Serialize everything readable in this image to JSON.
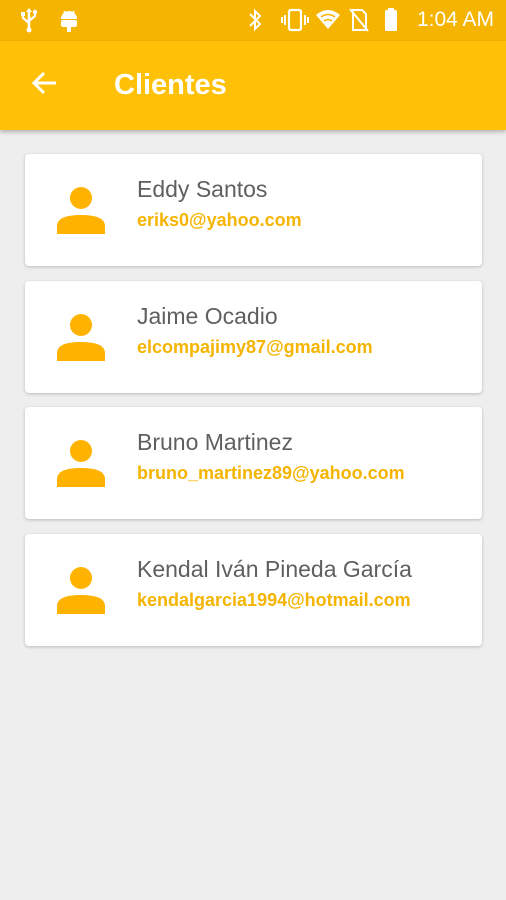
{
  "status_bar": {
    "time": "1:04 AM",
    "icons": [
      "usb-icon",
      "android-debug-icon",
      "bluetooth-icon",
      "vibrate-icon",
      "wifi-icon",
      "no-sim-icon",
      "battery-icon"
    ]
  },
  "app_bar": {
    "title": "Clientes",
    "back_icon": "arrow-back-icon"
  },
  "colors": {
    "status_bar": "#f5b400",
    "app_bar": "#ffc107",
    "accent": "#f5b400",
    "background": "#eeeeee"
  },
  "clients": [
    {
      "name": "Eddy Santos",
      "email": "eriks0@yahoo.com",
      "icon": "person-icon"
    },
    {
      "name": "Jaime Ocadio",
      "email": "elcompajimy87@gmail.com",
      "icon": "person-icon"
    },
    {
      "name": "Bruno Martinez",
      "email": "bruno_martinez89@yahoo.com",
      "icon": "person-icon"
    },
    {
      "name": "Kendal Iván Pineda García",
      "email": "kendalgarcia1994@hotmail.com",
      "icon": "person-icon"
    }
  ]
}
